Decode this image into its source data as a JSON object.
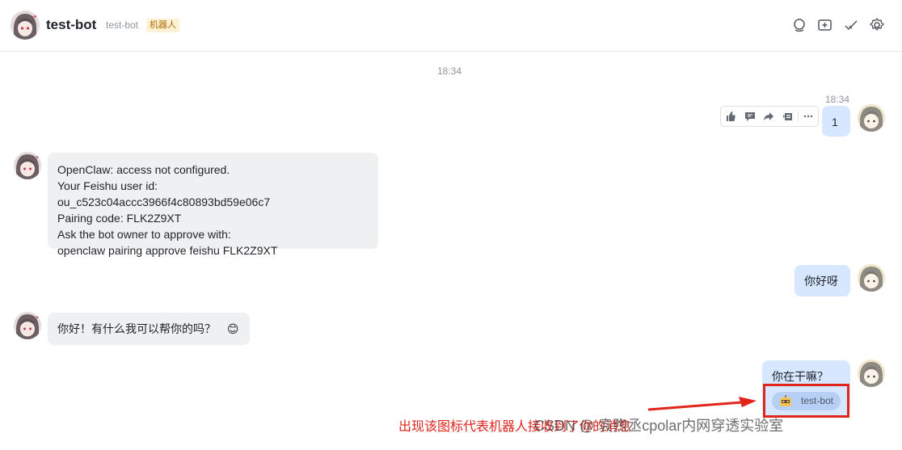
{
  "header": {
    "title": "test-bot",
    "subtitle": "test-bot",
    "badge": "机器人",
    "actions": [
      "search-icon",
      "new-window-icon",
      "done-icon",
      "settings-icon"
    ]
  },
  "timestamps": {
    "center": "18:34",
    "message": "18:34"
  },
  "messages": [
    {
      "sender": "me",
      "text": "1"
    },
    {
      "sender": "bot",
      "lines": [
        "OpenClaw: access not configured.",
        "Your Feishu user id: ou_c523c04accc3966f4c80893bd59e06c7",
        "Pairing code: FLK2Z9XT",
        "Ask the bot owner to approve with:",
        "openclaw pairing approve feishu FLK2Z9XT"
      ]
    },
    {
      "sender": "me",
      "text": "你好呀"
    },
    {
      "sender": "bot",
      "text": "你好！有什么我可以帮你的吗？",
      "emoji": "😊"
    },
    {
      "sender": "me",
      "text": "你在干嘛？",
      "chip": "test-bot"
    }
  ],
  "hover_toolbar": [
    "thumb-up-icon",
    "comment-icon",
    "forward-icon",
    "reply-icon",
    "more-icon"
  ],
  "annotation": "出现该图标代表机器人接收到了你的消息",
  "watermark": "CSDN @ 袁煦丞cpolar内网穿透实验室",
  "colors": {
    "incoming_bubble": "#eff0f1",
    "outgoing_bubble": "#d7e7ff",
    "badge_bg": "#fdf1d6",
    "badge_text": "#b26a00",
    "annotation": "#e1251b",
    "chip_bg": "#b7cff5"
  }
}
